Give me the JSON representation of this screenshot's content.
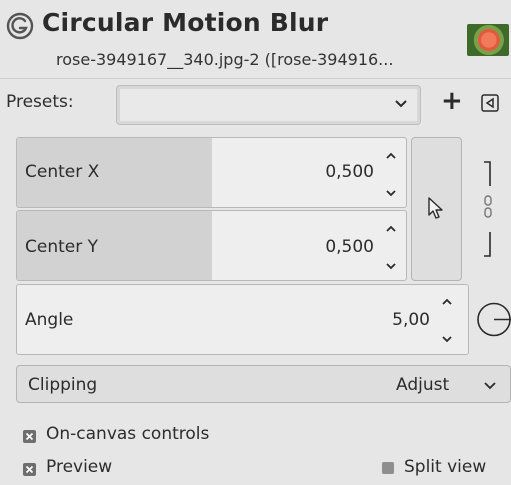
{
  "header": {
    "title": "Circular Motion Blur",
    "subtitle": "rose-3949167__340.jpg-2 ([rose-394916...",
    "icon": "gegl-icon",
    "thumbnail": "image-thumbnail"
  },
  "presets": {
    "label": "Presets:",
    "value": "",
    "add_label": "+",
    "menu_icon": "triangle-left-icon"
  },
  "center_x": {
    "label": "Center X",
    "value": "0,500",
    "fill_fraction": 0.5
  },
  "center_y": {
    "label": "Center Y",
    "value": "0,500",
    "fill_fraction": 0.5
  },
  "angle": {
    "label": "Angle",
    "value": "5,00",
    "fill_fraction": 0.0
  },
  "picker": {
    "icon": "pointer-icon"
  },
  "chain": {
    "icon": "chain-link-icon"
  },
  "dial": {
    "icon": "angle-dial-icon"
  },
  "clipping": {
    "label": "Clipping",
    "value": "Adjust"
  },
  "checkboxes": {
    "on_canvas": {
      "label": "On-canvas controls",
      "checked": true
    },
    "preview": {
      "label": "Preview",
      "checked": true
    },
    "split_view": {
      "label": "Split view",
      "checked": false
    }
  },
  "colors": {
    "background": "#e6e6e6",
    "field_fill": "#d2d2d2",
    "field_bg": "#eeeeee"
  }
}
